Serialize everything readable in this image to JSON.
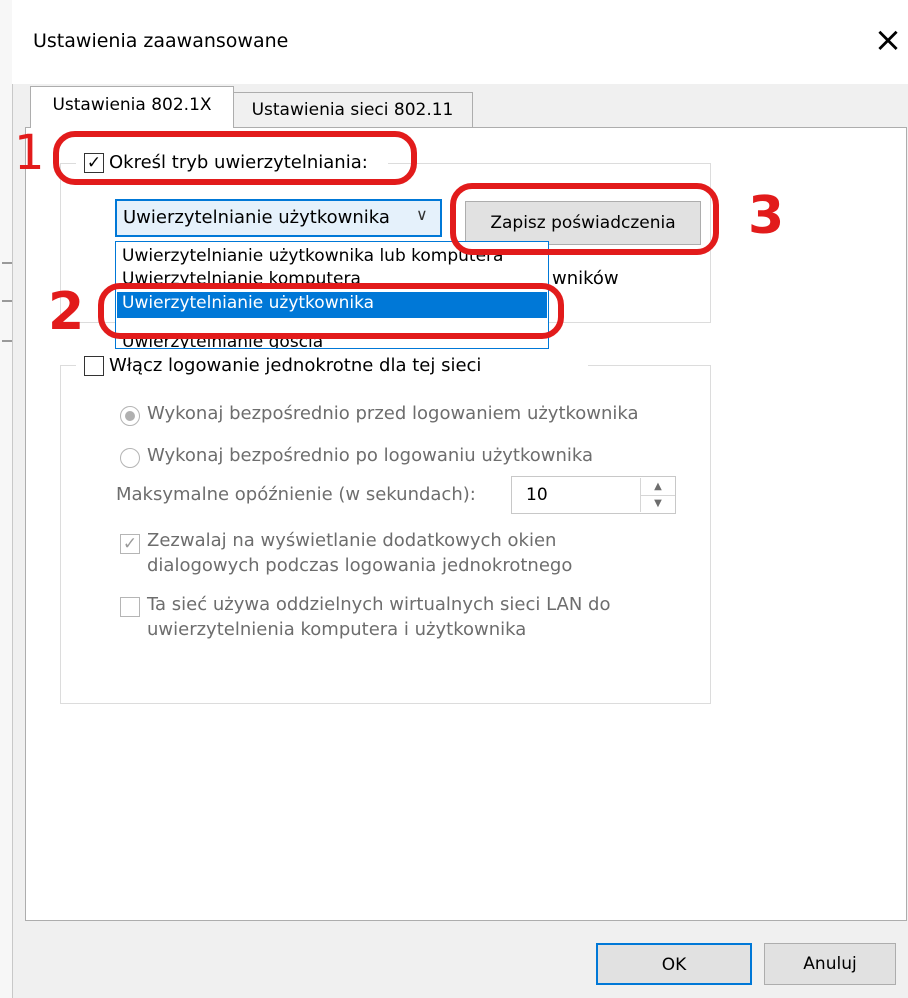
{
  "dialog": {
    "title": "Ustawienia zaawansowane",
    "close_glyph": "×"
  },
  "tabs": [
    {
      "label": "Ustawienia 802.1X",
      "active": true
    },
    {
      "label": "Ustawienia sieci 802.11",
      "active": false
    }
  ],
  "auth_mode": {
    "checkbox_label": "Określ tryb uwierzytelniania:",
    "checked": true,
    "combo_value": "Uwierzytelnianie użytkownika",
    "combo_arrow": "∨",
    "save_credentials_label": "Zapisz poświadczenia",
    "partial_hidden_text": "wników",
    "options": [
      "Uwierzytelnianie użytkownika lub komputera",
      "Uwierzytelnianie komputera",
      "Uwierzytelnianie użytkownika",
      "Uwierzytelnianie gościa"
    ],
    "selected_option_index": 2
  },
  "sso": {
    "checkbox_label": "Włącz logowanie jednokrotne dla tej sieci",
    "checked": false,
    "radio_before": "Wykonaj bezpośrednio przed logowaniem użytkownika",
    "radio_after": "Wykonaj bezpośrednio po logowaniu użytkownika",
    "selected_radio": "before",
    "max_delay_label": "Maksymalne opóźnienie (w sekundach):",
    "max_delay_value": "10",
    "allow_dialogs_line1": "Zezwalaj na wyświetlanie dodatkowych okien",
    "allow_dialogs_line2": "dialogowych podczas logowania jednokrotnego",
    "allow_dialogs_checked": true,
    "separate_vlan_line1": "Ta sieć używa oddzielnych wirtualnych sieci LAN do",
    "separate_vlan_line2": "uwierzytelnienia komputera i użytkownika",
    "separate_vlan_checked": false
  },
  "buttons": {
    "ok": "OK",
    "cancel": "Anuluj"
  },
  "annotations": [
    "1",
    "2",
    "3"
  ],
  "colors": {
    "annotation_red": "#e21b1b",
    "selection_blue": "#0078d7"
  }
}
